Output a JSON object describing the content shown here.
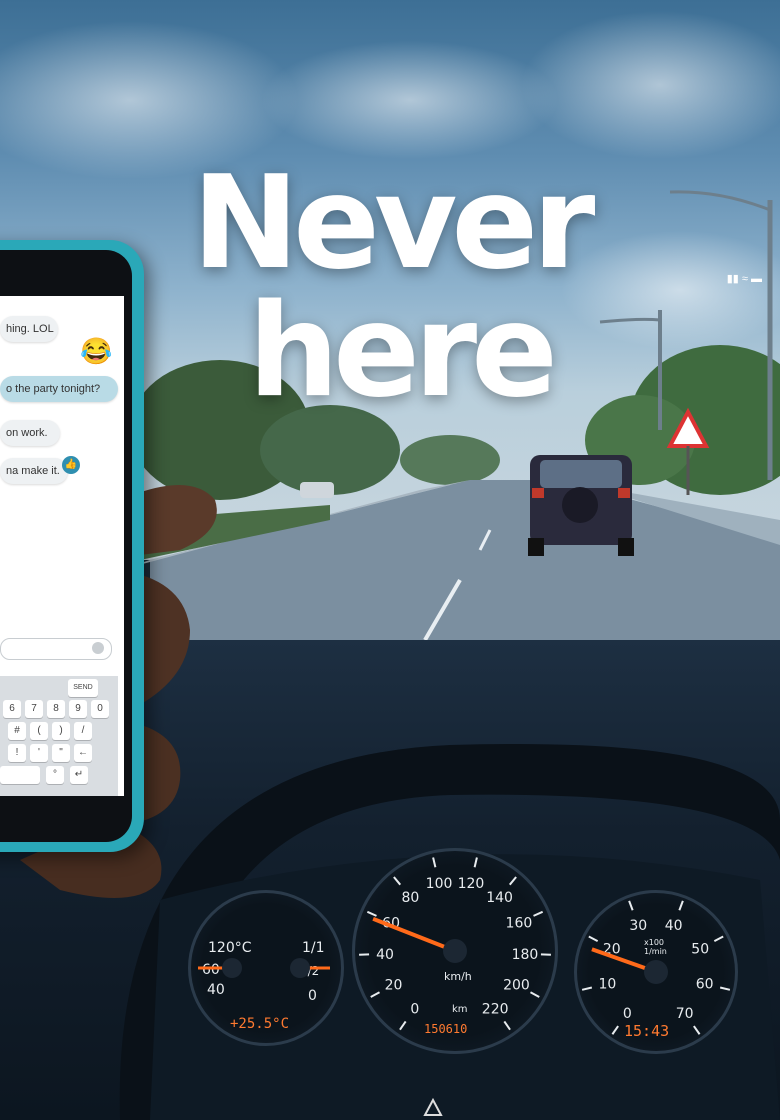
{
  "headline": {
    "line1": "Never",
    "line2": "here"
  },
  "phone": {
    "messages": [
      {
        "text": "hing. LOL",
        "side": "in"
      },
      {
        "text": "😂",
        "side": "emoji"
      },
      {
        "text": "o the party tonight?",
        "side": "out"
      },
      {
        "text": "on work.",
        "side": "in"
      },
      {
        "text": "na make it.",
        "side": "in"
      }
    ],
    "send_label": "SEND",
    "keyboard_rows": [
      [
        "6",
        "7",
        "8",
        "9",
        "0"
      ],
      [
        "#",
        "(",
        ")",
        "/"
      ],
      [
        "!",
        "'",
        "\"",
        "←"
      ],
      [
        "°",
        "↵"
      ]
    ]
  },
  "dashboard": {
    "temp_gauge": {
      "labels": [
        "120°C",
        "60",
        "40"
      ],
      "readout": "+25.5°C"
    },
    "fuel_gauge": {
      "labels": [
        "1/1",
        "1/2",
        "0"
      ]
    },
    "speedometer": {
      "labels": [
        "0",
        "20",
        "40",
        "60",
        "80",
        "100",
        "120",
        "140",
        "160",
        "180",
        "200",
        "220"
      ],
      "unit": "km/h",
      "odometer_unit": "km",
      "odometer": "150610"
    },
    "tachometer": {
      "labels": [
        "0",
        "10",
        "20",
        "30",
        "40",
        "50",
        "60",
        "70"
      ],
      "unit": "x100\n1/min"
    },
    "clock": "15:43"
  },
  "colors": {
    "needle": "#ff6a1a",
    "phone_case": "#2aa8b8",
    "gauge_text": "#e8ecef"
  }
}
